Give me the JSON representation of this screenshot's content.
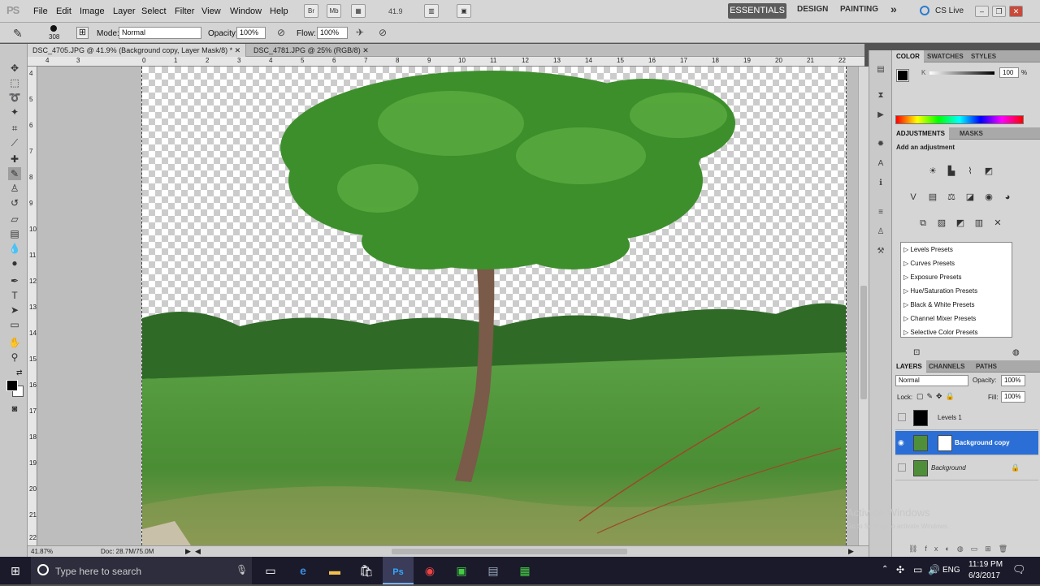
{
  "app": {
    "logo": "PS",
    "zoom": "41.9"
  },
  "menu": [
    "File",
    "Edit",
    "Image",
    "Layer",
    "Select",
    "Filter",
    "View",
    "Window",
    "Help"
  ],
  "toolbar_icons": [
    "Br",
    "Mb"
  ],
  "workspace": {
    "essentials": "ESSENTIALS",
    "design": "DESIGN",
    "painting": "PAINTING",
    "more": "»",
    "cslive": "CS Live"
  },
  "options": {
    "brush_size": "308",
    "mode_label": "Mode:",
    "mode_value": "Normal",
    "opacity_label": "Opacity:",
    "opacity_value": "100%",
    "flow_label": "Flow:",
    "flow_value": "100%"
  },
  "tabs": [
    {
      "label": "DSC_4705.JPG @ 41.9% (Background copy, Layer Mask/8) *"
    },
    {
      "label": "DSC_4781.JPG @ 25% (RGB/8)"
    }
  ],
  "ruler_top": [
    "4",
    "3",
    "",
    "0",
    "1",
    "2",
    "3",
    "4",
    "5",
    "6",
    "7",
    "8",
    "9",
    "10",
    "11",
    "12",
    "13",
    "14",
    "15",
    "16",
    "17",
    "18",
    "19",
    "20",
    "21",
    "22"
  ],
  "ruler_left": [
    "4",
    "5",
    "6",
    "7",
    "8",
    "9",
    "10",
    "11",
    "12",
    "13",
    "14",
    "15",
    "16",
    "17",
    "18",
    "19",
    "20",
    "21",
    "22"
  ],
  "status": {
    "zoom": "41.87%",
    "doc": "Doc: 28.7M/75.0M"
  },
  "color_panel": {
    "tabs": [
      "COLOR",
      "SWATCHES",
      "STYLES"
    ],
    "k_label": "K",
    "k_value": "100",
    "pct": "%"
  },
  "adjustments": {
    "tabs": [
      "ADJUSTMENTS",
      "MASKS"
    ],
    "heading": "Add an adjustment",
    "presets": [
      "Levels Presets",
      "Curves Presets",
      "Exposure Presets",
      "Hue/Saturation Presets",
      "Black & White Presets",
      "Channel Mixer Presets",
      "Selective Color Presets"
    ]
  },
  "layers_panel": {
    "tabs": [
      "LAYERS",
      "CHANNELS",
      "PATHS"
    ],
    "blend": "Normal",
    "opacity_label": "Opacity:",
    "opacity_value": "100%",
    "lock_label": "Lock:",
    "fill_label": "Fill:",
    "fill_value": "100%",
    "layers": [
      {
        "name": "Levels 1",
        "selected": false,
        "visible": false
      },
      {
        "name": "Background copy",
        "selected": true,
        "visible": true
      },
      {
        "name": "Background",
        "selected": false,
        "visible": false
      }
    ]
  },
  "watermark": {
    "line1": "Activate Windows",
    "line2": "Go to Settings to activate Windows."
  },
  "taskbar": {
    "search": "Type here to search",
    "lang": "ENG",
    "time": "11:19 PM",
    "date": "6/3/2017"
  },
  "colors": {
    "accent": "#2b6fd6",
    "foliage": "#3d8f2c",
    "grass": "#4d9a3a"
  }
}
